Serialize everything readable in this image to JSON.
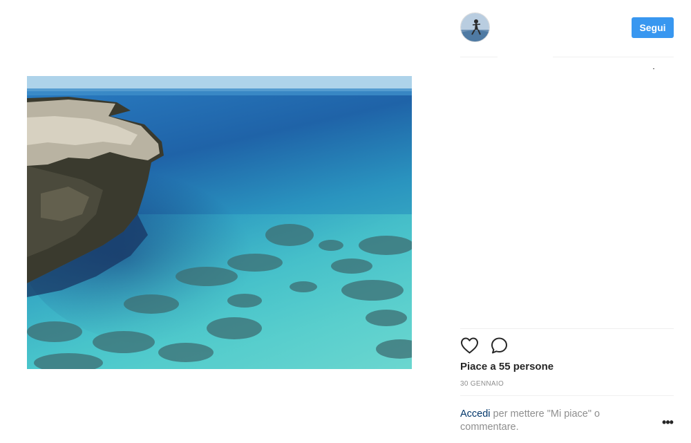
{
  "post": {
    "image_icon": "seascape-photo",
    "likes_text": "Piace a 55 persone",
    "date": "30 GENNAIO"
  },
  "header": {
    "avatar_icon": "profile-avatar",
    "follow_label": "Segui"
  },
  "actions": {
    "like_icon": "heart-icon",
    "comment_icon": "comment-icon",
    "more_icon": "more-options-icon",
    "more_glyph": "•••"
  },
  "login_prompt": {
    "link_text": "Accedi",
    "rest_text": " per mettere \"Mi piace\" o commentare."
  },
  "colors": {
    "accent": "#3897f0",
    "link": "#003569",
    "muted": "#8e8e8e"
  }
}
